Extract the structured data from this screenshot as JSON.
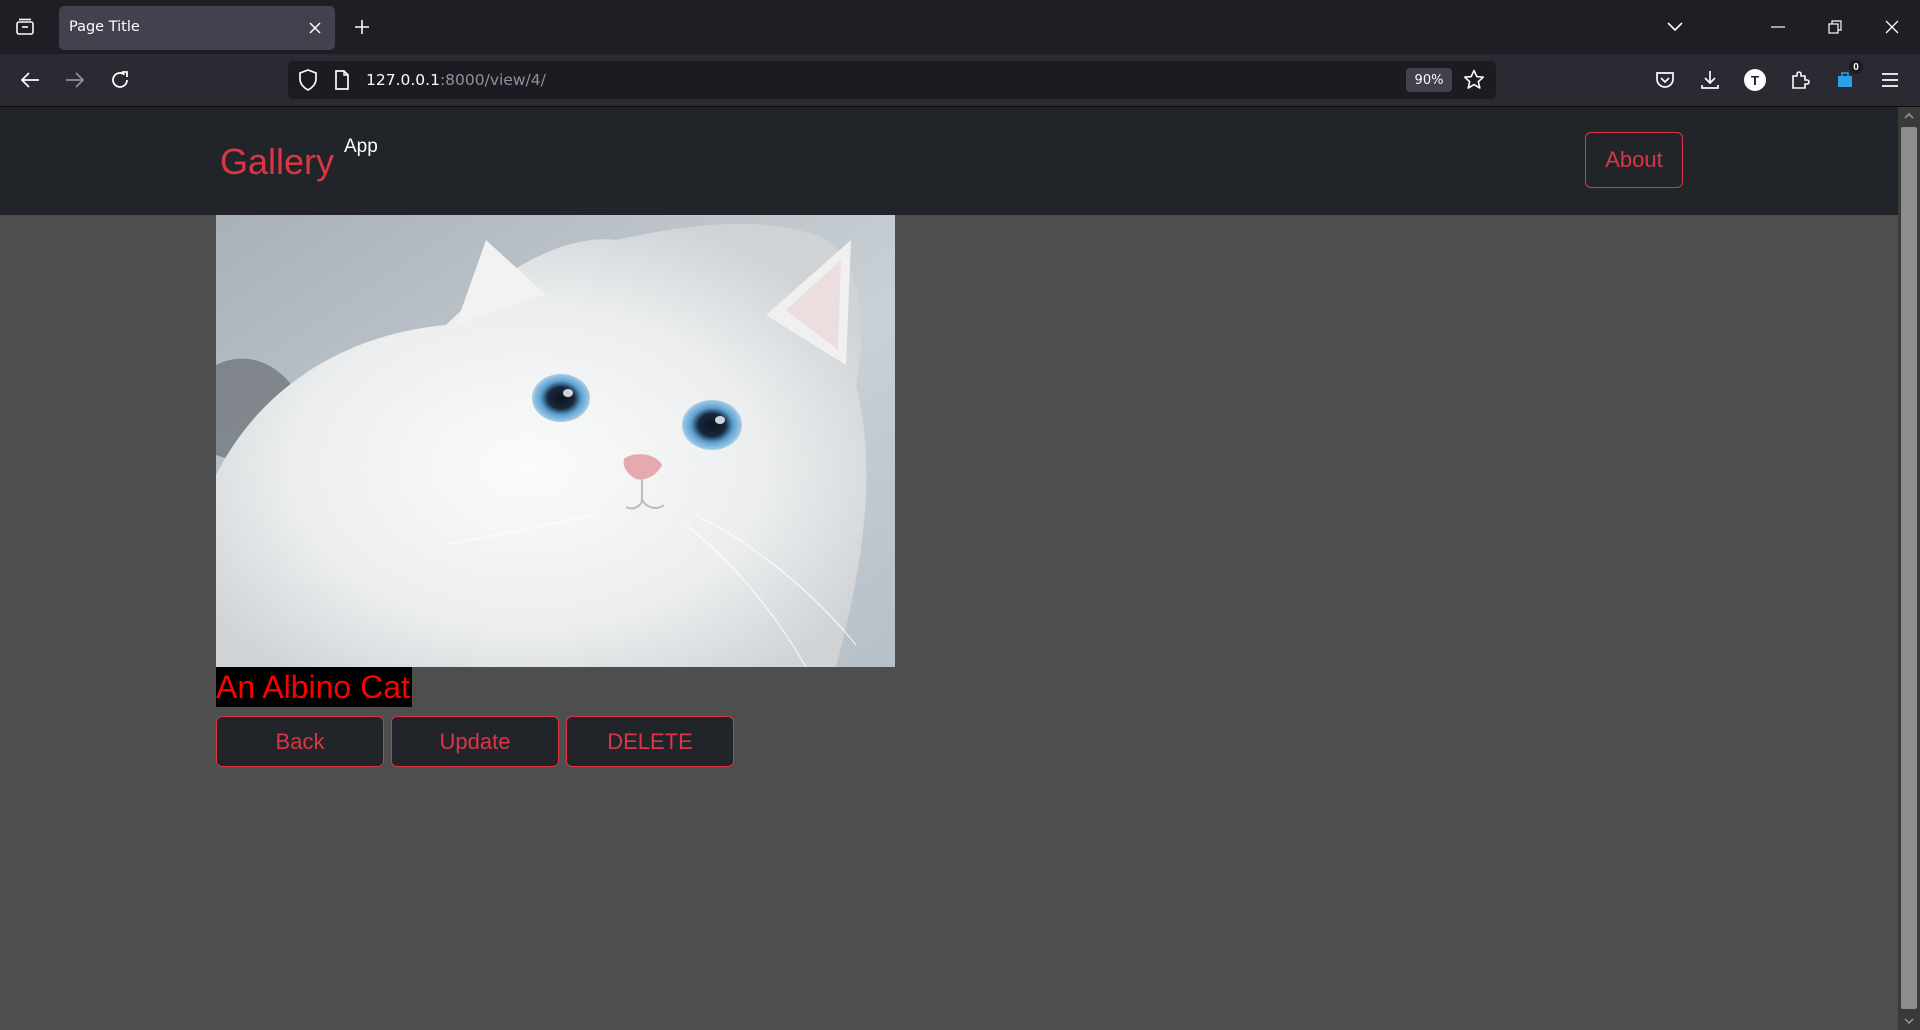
{
  "browser": {
    "tab_title": "Page Title",
    "url_host": "127.0.0.1",
    "url_path": ":8000/view/4/",
    "zoom": "90%",
    "extension_badge_count": "0",
    "profile_initial": "T"
  },
  "header": {
    "brand": "Gallery",
    "brand_sup": "App",
    "about_label": "About"
  },
  "photo": {
    "caption": "An Albino Cat"
  },
  "actions": {
    "back_label": "Back",
    "update_label": "Update",
    "delete_label": "DELETE"
  },
  "colors": {
    "accent": "#dc3545",
    "caption_text": "#ff0000",
    "page_bg": "#4e4e4e",
    "header_bg": "#212529"
  }
}
